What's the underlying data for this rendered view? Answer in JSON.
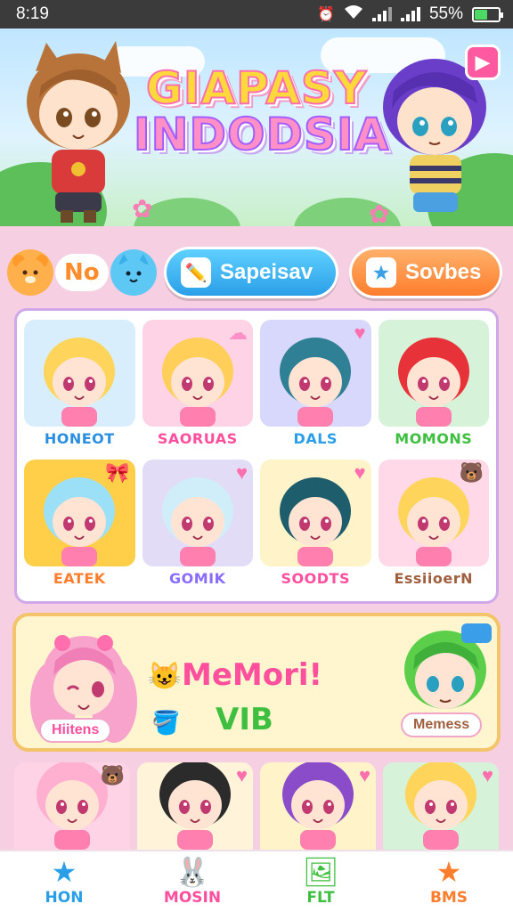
{
  "status_bar": {
    "time": "8:19",
    "battery_percent": "55%",
    "battery_level": 0.55,
    "icons": [
      "alarm-icon",
      "wifi-icon",
      "signal-icon",
      "signal-icon",
      "battery-icon"
    ]
  },
  "header": {
    "logo_line1": "GIAPASY",
    "logo_line2": "INDODSIA",
    "play_icon": "play-icon"
  },
  "nav": {
    "mascot_label": "No",
    "btn_primary": "Sapeisav",
    "btn_secondary": "Sovbes",
    "colors": {
      "primary": "#2a9fe8",
      "secondary": "#ff7e2e"
    }
  },
  "characters": [
    {
      "name": "HONEOT",
      "color": "#2a8fe0",
      "bg": "#d9eefc",
      "hair": "#ffd45a",
      "badge": ""
    },
    {
      "name": "SAORUAS",
      "color": "#ff4f9d",
      "bg": "#ffd3e6",
      "hair": "#ffcf5a",
      "badge": "cloud-icon"
    },
    {
      "name": "DALS",
      "color": "#2a9fe8",
      "bg": "#d7d8fb",
      "hair": "#2f7f95",
      "badge": "heart-icon"
    },
    {
      "name": "MOMONS",
      "color": "#3fbf3f",
      "bg": "#d6f3da",
      "hair": "#e8323a",
      "badge": ""
    },
    {
      "name": "EATEK",
      "color": "#ff7e2e",
      "bg": "#ffcf4a",
      "hair": "#9be0f7",
      "badge": "bow-icon"
    },
    {
      "name": "GOMIK",
      "color": "#8a6cff",
      "bg": "#e3dcf7",
      "hair": "#cfeefa",
      "badge": "heart-icon"
    },
    {
      "name": "SOODTS",
      "color": "#ff4f9d",
      "bg": "#fff3c9",
      "hair": "#1e5d6b",
      "badge": "heart-icon"
    },
    {
      "name": "EssiioerN",
      "color": "#a06040",
      "bg": "#ffd9e8",
      "hair": "#ffd45a",
      "badge": "bear-icon"
    }
  ],
  "promo": {
    "title": "MeMori!",
    "subtitle": "VIB",
    "left_tag": "Hiitens",
    "right_tag": "Memess"
  },
  "bottom_cards": [
    {
      "bg": "#ffd3e6",
      "hair": "#ffb0d0",
      "badge": "bear-icon"
    },
    {
      "bg": "#fff4d9",
      "hair": "#2b2b2b",
      "badge": "heart-icon"
    },
    {
      "bg": "#fff3c9",
      "hair": "#8b4cc9",
      "badge": "heart-icon"
    },
    {
      "bg": "#d6f3da",
      "hair": "#ffd45a",
      "badge": "heart-icon"
    }
  ],
  "tabs": [
    {
      "label": "HON",
      "color": "#2a9fe8",
      "icon": "star-icon"
    },
    {
      "label": "MOSIN",
      "color": "#ff4f9d",
      "icon": "bunny-icon"
    },
    {
      "label": "FLT",
      "color": "#3fbf3f",
      "icon": "image-icon"
    },
    {
      "label": "BMS",
      "color": "#ff7e2e",
      "icon": "star-icon"
    }
  ]
}
